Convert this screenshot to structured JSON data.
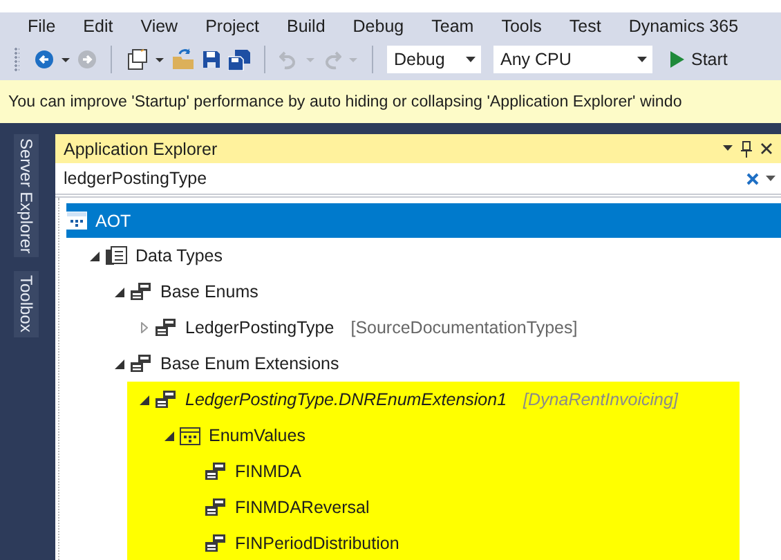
{
  "menu": [
    "File",
    "Edit",
    "View",
    "Project",
    "Build",
    "Debug",
    "Team",
    "Tools",
    "Test",
    "Dynamics 365"
  ],
  "toolbar": {
    "groups": [
      [
        {
          "kind": "back",
          "disabled": false
        },
        {
          "kind": "caret",
          "disabled": false
        },
        {
          "kind": "forward",
          "disabled": true
        }
      ],
      [
        {
          "kind": "new-project",
          "disabled": false
        },
        {
          "kind": "caret",
          "disabled": false
        },
        {
          "kind": "open",
          "disabled": false
        },
        {
          "kind": "save",
          "disabled": false
        },
        {
          "kind": "save-all",
          "disabled": false
        }
      ],
      [
        {
          "kind": "undo",
          "disabled": true
        },
        {
          "kind": "caret",
          "disabled": true
        },
        {
          "kind": "redo",
          "disabled": true
        },
        {
          "kind": "caret",
          "disabled": true
        }
      ]
    ],
    "dropdowns": [
      {
        "value": "Debug"
      },
      {
        "value": "Any CPU"
      }
    ],
    "start": {
      "label": "Start"
    }
  },
  "info_bar": {
    "message": "You can improve 'Startup' performance by auto hiding or collapsing 'Application Explorer' windo"
  },
  "side_tabs": [
    "Server Explorer",
    "Toolbox"
  ],
  "explorer": {
    "title": "Application Explorer",
    "search": {
      "value": "ledgerPostingType"
    },
    "tree": [
      {
        "label": "AOT",
        "kind": "aot",
        "selected": true,
        "highlighted": false,
        "children": [
          {
            "label": "Data Types",
            "kind": "folder",
            "selected": false,
            "highlighted": false,
            "expanded": true,
            "children": [
              {
                "label": "Base Enums",
                "kind": "enum",
                "selected": false,
                "highlighted": false,
                "expanded": true,
                "children": [
                  {
                    "label": "LedgerPostingType",
                    "suffix": "[SourceDocumentationTypes]",
                    "kind": "enum",
                    "selected": false,
                    "highlighted": false,
                    "expanded": false
                  }
                ]
              },
              {
                "label": "Base Enum Extensions",
                "kind": "enum",
                "selected": false,
                "highlighted": false,
                "expanded": true,
                "children": [
                  {
                    "label": "LedgerPostingType.DNREnumExtension1",
                    "suffix": "[DynaRentInvoicing]",
                    "kind": "extension",
                    "selected": false,
                    "highlighted": true,
                    "expanded": true,
                    "children": [
                      {
                        "label": "EnumValues",
                        "kind": "values",
                        "selected": false,
                        "highlighted": true,
                        "expanded": true,
                        "children": [
                          {
                            "label": "FINMDA",
                            "kind": "enum",
                            "selected": false,
                            "highlighted": true
                          },
                          {
                            "label": "FINMDAReversal",
                            "kind": "enum",
                            "selected": false,
                            "highlighted": true
                          },
                          {
                            "label": "FINPeriodDistribution",
                            "kind": "enum",
                            "selected": false,
                            "highlighted": true
                          }
                        ]
                      }
                    ]
                  }
                ]
              }
            ]
          }
        ]
      }
    ]
  }
}
